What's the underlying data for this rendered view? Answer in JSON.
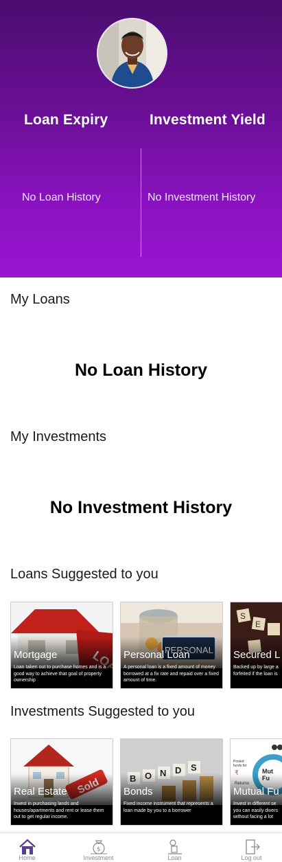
{
  "profile": {
    "avatar_alt": "user-avatar"
  },
  "stats": {
    "loan_expiry_title": "Loan Expiry",
    "investment_yield_title": "Investment Yield",
    "loan_expiry_value": "No Loan History",
    "investment_yield_value": "No Investment History"
  },
  "my_loans": {
    "title": "My Loans",
    "empty": "No Loan History"
  },
  "my_investments": {
    "title": "My Investments",
    "empty": "No Investment History"
  },
  "loans_suggested": {
    "title": "Loans Suggested to you",
    "cards": [
      {
        "label": "Mortgage",
        "desc": "Loan taken out to purchase homes and is a good way to achieve that goal of property ownership"
      },
      {
        "label": "Personal Loan",
        "desc": "A personal loan is a fixed amount of money borrowed at a fix rate and repaid over a fixed amount of time."
      },
      {
        "label": "Secured L",
        "desc": "Backed up by large a forfeited if the loan is"
      }
    ]
  },
  "investments_suggested": {
    "title": "Investments Suggested to you",
    "cards": [
      {
        "label": "Real Estate",
        "desc": "Invest in purchasing lands and houses/apartments and rent or lease them out to get regular income."
      },
      {
        "label": "Bonds",
        "desc": "Fixed income instrument that represents a loan made by you to a borrower"
      },
      {
        "label": "Mutual Fu",
        "desc": "Invest in different se you can easily divers without facing a lot"
      }
    ]
  },
  "nav": {
    "home": "Home",
    "investment": "Investment",
    "loan": "Loan",
    "logout": "Log out"
  },
  "colors": {
    "hero_top": "#4a0d6e",
    "hero_bottom": "#9a14d2",
    "nav_active": "#5b3f8f"
  }
}
